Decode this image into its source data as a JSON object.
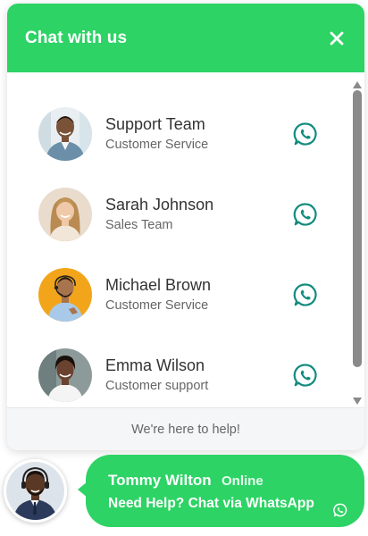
{
  "header": {
    "title": "Chat with us",
    "close_icon": "close-icon"
  },
  "agents": [
    {
      "name": "Support Team",
      "role": "Customer Service",
      "avatar_bg": "#e8eef2",
      "shirt": "#6b8fa8",
      "skin": "#7a5238"
    },
    {
      "name": "Sarah Johnson",
      "role": "Sales Team",
      "avatar_bg": "#e9dccd",
      "shirt": "#f2e6d8",
      "skin": "#f0c9a8"
    },
    {
      "name": "Michael Brown",
      "role": "Customer Service",
      "avatar_bg": "#f2a51a",
      "shirt": "#a9c9e8",
      "skin": "#a8744e"
    },
    {
      "name": "Emma Wilson",
      "role": "Customer support",
      "avatar_bg": "#8c9a9a",
      "shirt": "#f4f4f4",
      "skin": "#6a4230"
    }
  ],
  "footer": {
    "text": "We're here to help!"
  },
  "launcher": {
    "name": "Tommy Wilton",
    "status": "Online",
    "cta": "Need Help? Chat via WhatsApp"
  },
  "colors": {
    "accent": "#2dd365",
    "whatsapp_icon": "#128c7e",
    "text_primary": "#333333",
    "text_secondary": "#666666"
  }
}
